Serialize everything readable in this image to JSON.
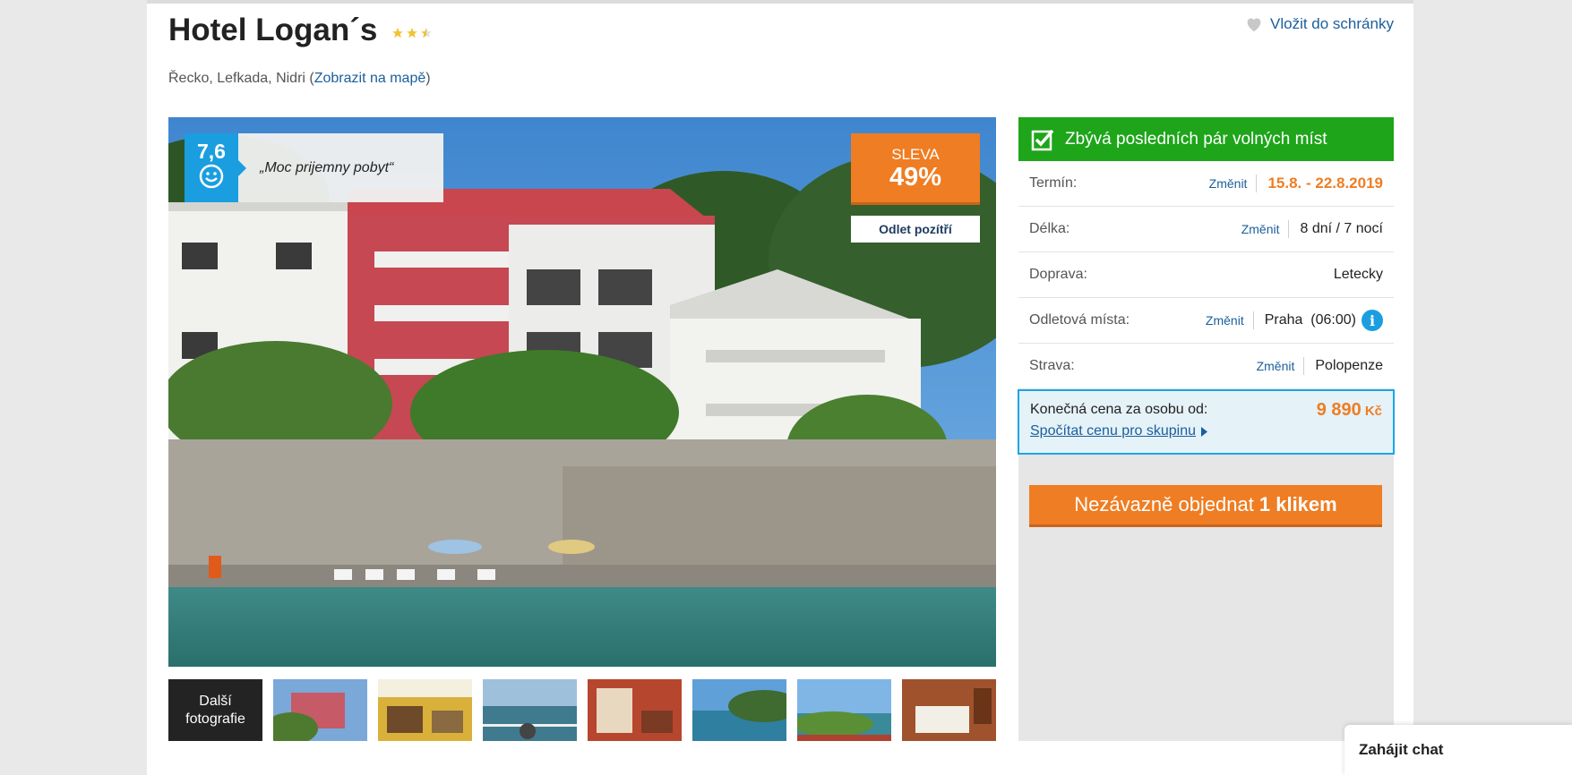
{
  "hotel": {
    "name": "Hotel Logan´s",
    "stars": 2.5,
    "favorite_label": "Vložit do schránky",
    "location_prefix": "Řecko, Lefkada, Nidri (",
    "map_link": "Zobrazit na mapě",
    "location_suffix": ")"
  },
  "photo": {
    "rating_score": "7,6",
    "rating_quote": "„Moc prijemny pobyt“",
    "discount_label": "SLEVA",
    "discount_value": "49%",
    "departure_badge": "Odlet pozítří",
    "more_photos_line1": "Další",
    "more_photos_line2": "fotografie",
    "thumbnail_count": 7
  },
  "booking": {
    "availability": "Zbývá posledních pár volných míst",
    "rows": [
      {
        "label": "Termín:",
        "change": "Změnit",
        "value": "15.8. - 22.8.2019"
      },
      {
        "label": "Délka:",
        "change": "Změnit",
        "value": "8 dní / 7 nocí"
      },
      {
        "label": "Doprava:",
        "change": "",
        "value": "Letecky"
      },
      {
        "label": "Odletová místa:",
        "change": "Změnit",
        "value": "Praha  (06:00)"
      },
      {
        "label": "Strava:",
        "change": "Změnit",
        "value": "Polopenze"
      }
    ],
    "price_label": "Konečná cena za osobu od:",
    "price_value": "9 890",
    "price_currency": "Kč",
    "group_price_link": "Spočítat cenu pro skupinu",
    "order_button_prefix": "Nezávazně objednat",
    "order_button_bold": "1 klikem"
  },
  "chat": {
    "label": "Zahájit chat"
  },
  "colors": {
    "accent_orange": "#ef7d23",
    "availability_green": "#1ea51a",
    "rating_blue": "#1a9ee0",
    "link_blue": "#1b5e9c"
  }
}
